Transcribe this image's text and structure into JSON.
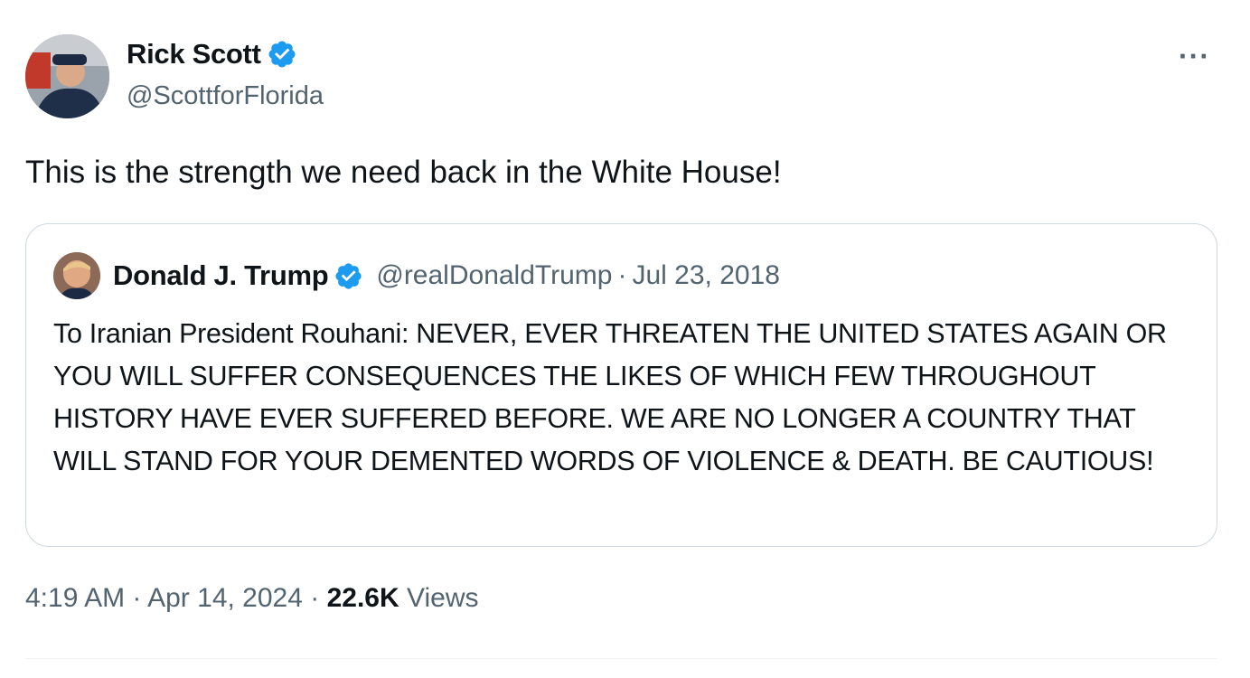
{
  "author": {
    "display_name": "Rick Scott",
    "handle": "@ScottforFlorida",
    "verified_icon": "verified-badge-icon",
    "avatar_icon": "avatar"
  },
  "more_label": "···",
  "tweet": {
    "text": "This is the strength we need back in the White House!"
  },
  "quote": {
    "display_name": "Donald J. Trump",
    "handle": "@realDonaldTrump",
    "separator": "·",
    "date": "Jul 23, 2018",
    "text": "To Iranian President Rouhani: NEVER, EVER THREATEN THE UNITED STATES AGAIN OR YOU WILL SUFFER CONSEQUENCES THE LIKES OF WHICH FEW THROUGHOUT HISTORY HAVE EVER SUFFERED BEFORE. WE ARE NO LONGER A COUNTRY THAT WILL STAND FOR YOUR DEMENTED WORDS OF VIOLENCE & DEATH. BE CAUTIOUS!"
  },
  "meta": {
    "time": "4:19 AM",
    "separator": "·",
    "date": "Apr 14, 2024",
    "views_count": "22.6K",
    "views_label": "Views"
  },
  "colors": {
    "verified": "#1d9bf0",
    "secondary_text": "#536471",
    "border": "#cfd9de"
  }
}
